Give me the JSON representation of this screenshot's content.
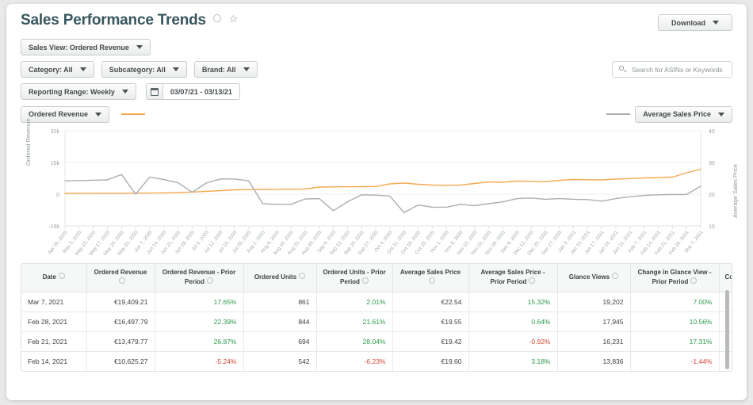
{
  "header": {
    "title": "Sales Performance Trends",
    "info_icon": "info-circle-icon",
    "favorite_icon": "star-icon",
    "download_label": "Download"
  },
  "filters": {
    "sales_view": "Sales View: Ordered Revenue",
    "category": "Category: All",
    "subcategory": "Subcategory: All",
    "brand": "Brand: All",
    "reporting_range": "Reporting Range: Weekly",
    "date_range": "03/07/21 - 03/13/21",
    "calendar_icon": "calendar-icon"
  },
  "search": {
    "placeholder": "Search for ASINs or Keywords",
    "value": "",
    "icon": "search-icon"
  },
  "chart_legend": {
    "primary_metric": "Ordered Revenue",
    "secondary_metric": "Average Sales Price",
    "primary_color": "#f5a951",
    "secondary_color": "#a9aeb0"
  },
  "chart_data": {
    "type": "line",
    "title": "Sales Performance Trends",
    "xlabel": "",
    "ylabel": "Ordered Revenue",
    "y2label": "Average Sales Price",
    "ylim": [
      -16000,
      32000
    ],
    "y2lim": [
      10,
      40
    ],
    "yticks": [
      "32k",
      "16k",
      "0",
      "-16k"
    ],
    "y2ticks": [
      "40",
      "30",
      "20",
      "10"
    ],
    "grid": true,
    "legend_position": "top",
    "categories": [
      "Apr 26, 2020",
      "May 3, 2020",
      "May 10, 2020",
      "May 17, 2020",
      "May 24, 2020",
      "May 31, 2020",
      "Jun 7, 2020",
      "Jun 14, 2020",
      "Jun 21, 2020",
      "Jun 28, 2020",
      "Jul 5, 2020",
      "Jul 12, 2020",
      "Jul 19, 2020",
      "Jul 26, 2020",
      "Aug 2, 2020",
      "Aug 9, 2020",
      "Aug 16, 2020",
      "Aug 23, 2020",
      "Aug 30, 2020",
      "Sep 6, 2020",
      "Sep 13, 2020",
      "Sep 20, 2020",
      "Sep 27, 2020",
      "Oct 4, 2020",
      "Oct 11, 2020",
      "Oct 18, 2020",
      "Oct 25, 2020",
      "Nov 1, 2020",
      "Nov 8, 2020",
      "Nov 15, 2020",
      "Nov 22, 2020",
      "Nov 29, 2020",
      "Dec 6, 2020",
      "Dec 13, 2020",
      "Dec 20, 2020",
      "Dec 27, 2020",
      "Jan 3, 2021",
      "Jan 10, 2021",
      "Jan 17, 2021",
      "Jan 24, 2021",
      "Jan 31, 2021",
      "Feb 7, 2021",
      "Feb 14, 2021",
      "Feb 21, 2021",
      "Feb 28, 2021",
      "Mar 7, 2021"
    ],
    "series": [
      {
        "name": "Ordered Revenue",
        "axis": "left",
        "color": "#f5a951",
        "values": [
          400,
          420,
          450,
          470,
          500,
          520,
          560,
          700,
          900,
          1100,
          1400,
          1800,
          2200,
          2300,
          2400,
          2450,
          2500,
          2600,
          3600,
          3700,
          3750,
          3800,
          3900,
          5200,
          5600,
          5000,
          4600,
          4500,
          4600,
          5400,
          6200,
          6000,
          6600,
          6500,
          6300,
          7000,
          7400,
          7300,
          7200,
          7600,
          7900,
          8200,
          8400,
          8600,
          10800,
          12600
        ]
      },
      {
        "name": "Average Sales Price",
        "axis": "right",
        "color": "#a9aeb0",
        "values": [
          24.2,
          24.3,
          24.4,
          24.5,
          26.2,
          20.0,
          25.4,
          24.6,
          23.6,
          20.6,
          23.5,
          24.8,
          24.8,
          24.2,
          17.0,
          16.8,
          16.8,
          18.5,
          18.6,
          14.8,
          17.6,
          19.8,
          19.7,
          19.4,
          14.2,
          16.6,
          15.9,
          15.9,
          16.8,
          16.4,
          17.0,
          17.6,
          18.6,
          18.8,
          18.4,
          18.6,
          18.4,
          18.3,
          17.8,
          18.6,
          19.2,
          19.6,
          19.8,
          19.9,
          19.9,
          22.5
        ]
      }
    ]
  },
  "table": {
    "columns": [
      "Date",
      "Ordered Revenue",
      "Ordered Revenue - Prior Period",
      "Ordered Units",
      "Ordered Units - Prior Period",
      "Average Sales Price",
      "Average Sales Price - Prior Period",
      "Glance Views",
      "Change in Glance View - Prior Period",
      "Co"
    ],
    "rows": [
      {
        "date": "Mar 7, 2021",
        "ordered_revenue": "€19,409.21",
        "ordered_revenue_prior": "17.65%",
        "ordered_revenue_prior_sign": "pos",
        "ordered_units": "861",
        "ordered_units_prior": "2.01%",
        "ordered_units_prior_sign": "pos",
        "avg_sales_price": "€22.54",
        "avg_sales_price_prior": "15.32%",
        "avg_sales_price_prior_sign": "pos",
        "glance_views": "19,202",
        "glance_views_prior": "7.00%",
        "glance_views_prior_sign": "pos",
        "last": ""
      },
      {
        "date": "Feb 28, 2021",
        "ordered_revenue": "€16,497.79",
        "ordered_revenue_prior": "22.39%",
        "ordered_revenue_prior_sign": "pos",
        "ordered_units": "844",
        "ordered_units_prior": "21.61%",
        "ordered_units_prior_sign": "pos",
        "avg_sales_price": "€19.55",
        "avg_sales_price_prior": "0.64%",
        "avg_sales_price_prior_sign": "pos",
        "glance_views": "17,945",
        "glance_views_prior": "10.56%",
        "glance_views_prior_sign": "pos",
        "last": ""
      },
      {
        "date": "Feb 21, 2021",
        "ordered_revenue": "€13,479.77",
        "ordered_revenue_prior": "26.87%",
        "ordered_revenue_prior_sign": "pos",
        "ordered_units": "694",
        "ordered_units_prior": "28.04%",
        "ordered_units_prior_sign": "pos",
        "avg_sales_price": "€19.42",
        "avg_sales_price_prior": "-0.92%",
        "avg_sales_price_prior_sign": "neg",
        "glance_views": "16,231",
        "glance_views_prior": "17.31%",
        "glance_views_prior_sign": "pos",
        "last": ""
      },
      {
        "date": "Feb 14, 2021",
        "ordered_revenue": "€10,625.27",
        "ordered_revenue_prior": "-5.24%",
        "ordered_revenue_prior_sign": "neg",
        "ordered_units": "542",
        "ordered_units_prior": "-6.23%",
        "ordered_units_prior_sign": "neg",
        "avg_sales_price": "€19.60",
        "avg_sales_price_prior": "3.18%",
        "avg_sales_price_prior_sign": "pos",
        "glance_views": "13,836",
        "glance_views_prior": "-1.44%",
        "glance_views_prior_sign": "neg",
        "last": ""
      }
    ]
  }
}
